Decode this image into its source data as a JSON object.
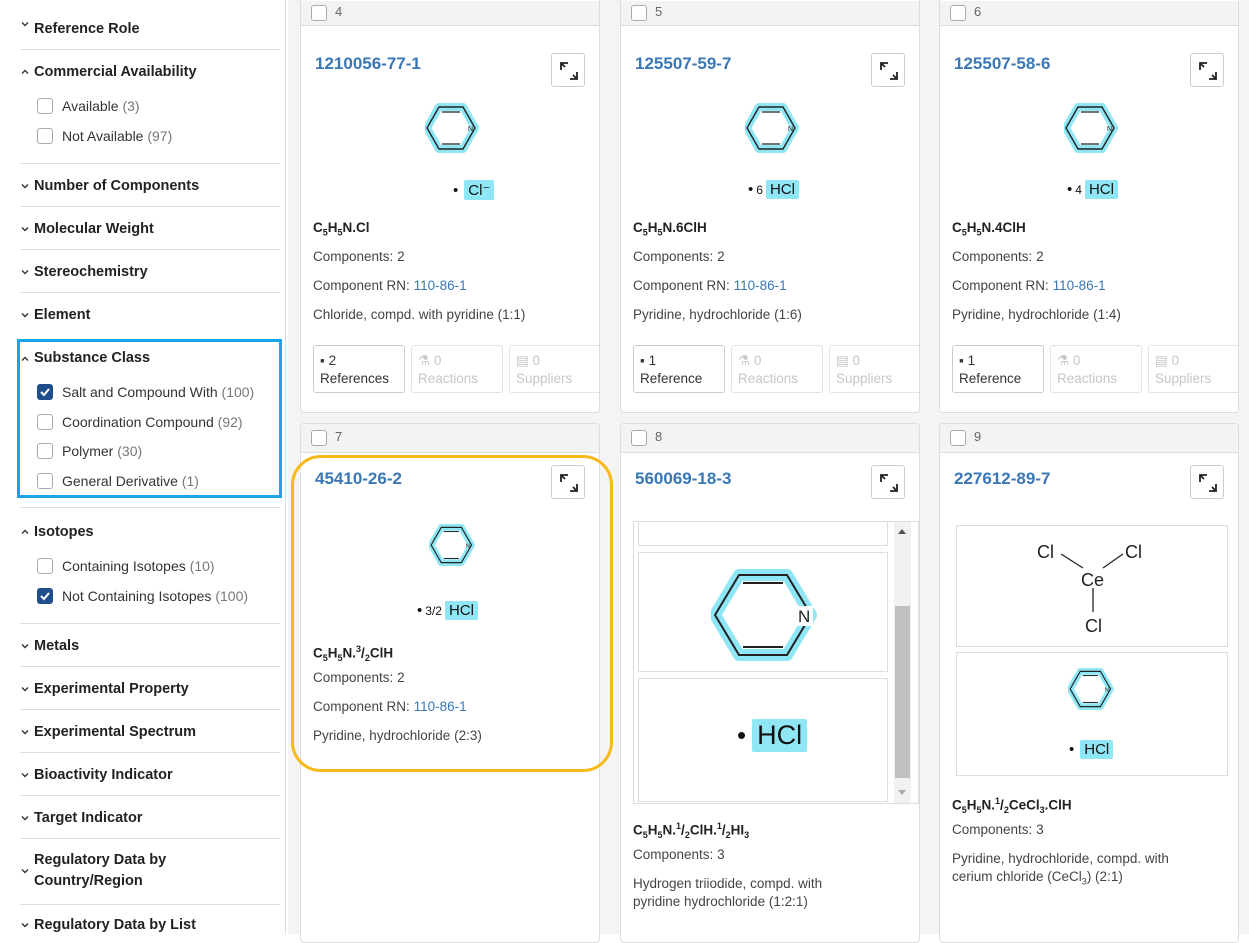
{
  "sidebar": {
    "reference_role": "Reference Role",
    "commercial": {
      "title": "Commercial Availability",
      "items": [
        {
          "label": "Available",
          "count": "(3)"
        },
        {
          "label": "Not Available",
          "count": "(97)"
        }
      ]
    },
    "number_of_components": "Number of Components",
    "molecular_weight": "Molecular Weight",
    "stereochemistry": "Stereochemistry",
    "element": "Element",
    "substance_class": {
      "title": "Substance Class",
      "items": [
        {
          "label": "Salt and Compound With",
          "count": "(100)",
          "checked": true
        },
        {
          "label": "Coordination Compound",
          "count": "(92)",
          "checked": false
        },
        {
          "label": "Polymer",
          "count": "(30)",
          "checked": false
        },
        {
          "label": "General Derivative",
          "count": "(1)",
          "checked": false
        }
      ]
    },
    "isotopes": {
      "title": "Isotopes",
      "items": [
        {
          "label": "Containing Isotopes",
          "count": "(10)",
          "checked": false
        },
        {
          "label": "Not Containing Isotopes",
          "count": "(100)",
          "checked": true
        }
      ]
    },
    "metals": "Metals",
    "experimental_property": "Experimental Property",
    "experimental_spectrum": "Experimental Spectrum",
    "bioactivity_indicator": "Bioactivity Indicator",
    "target_indicator": "Target Indicator",
    "regulatory_country_l1": "Regulatory Data by",
    "regulatory_country_l2": "Country/Region",
    "regulatory_list": "Regulatory Data by List"
  },
  "labels": {
    "components": "Components:",
    "component_rn": "Component RN:",
    "reactions": "Reactions",
    "suppliers": "Suppliers"
  },
  "cards": [
    {
      "num": "4",
      "rn": "1210056-77-1",
      "salt_ion": "Cl⁻",
      "formula_html": "C<sub>5</sub>H<sub>5</sub>N.Cl",
      "components": "2",
      "component_rn": "110-86-1",
      "name": "Chloride, compd. with pyridine (1:1)",
      "ref_count": "2",
      "ref_label": "References",
      "reactions": "0",
      "suppliers": "0"
    },
    {
      "num": "5",
      "rn": "125507-59-7",
      "salt_coef": "6",
      "salt_ion": "HCl",
      "formula_html": "C<sub>5</sub>H<sub>5</sub>N.6ClH",
      "components": "2",
      "component_rn": "110-86-1",
      "name": "Pyridine, hydrochloride (1:6)",
      "ref_count": "1",
      "ref_label": "Reference",
      "reactions": "0",
      "suppliers": "0"
    },
    {
      "num": "6",
      "rn": "125507-58-6",
      "salt_coef": "4",
      "salt_ion": "HCl",
      "formula_html": "C<sub>5</sub>H<sub>5</sub>N.4ClH",
      "components": "2",
      "component_rn": "110-86-1",
      "name": "Pyridine, hydrochloride (1:4)",
      "ref_count": "1",
      "ref_label": "Reference",
      "reactions": "0",
      "suppliers": "0"
    },
    {
      "num": "7",
      "rn": "45410-26-2",
      "salt_coef": "3/2",
      "salt_ion": "HCl",
      "formula_html": "C<sub>5</sub>H<sub>5</sub>N.<sup>3</sup>/<sub>2</sub>ClH",
      "components": "2",
      "component_rn": "110-86-1",
      "name": "Pyridine, hydrochloride (2:3)"
    },
    {
      "num": "8",
      "rn": "560069-18-3",
      "salt_ion": "HCl",
      "formula_html": "C<sub>5</sub>H<sub>5</sub>N.<sup>1</sup>/<sub>2</sub>ClH.<sup>1</sup>/<sub>2</sub>HI<sub>3</sub>",
      "components": "3",
      "name_l1": "Hydrogen triiodide, compd. with",
      "name_l2": "pyridine hydrochloride (1:2:1)"
    },
    {
      "num": "9",
      "rn": "227612-89-7",
      "salt_ion": "HCl",
      "formula_html": "C<sub>5</sub>H<sub>5</sub>N.<sup>1</sup>/<sub>2</sub>CeCl<sub>3</sub>.ClH",
      "components": "3",
      "name_l1": "Pyridine, hydrochloride, compd. with",
      "name_l2_html": "cerium chloride (CeCl<sub>3</sub>) (2:1)",
      "cecl3": {
        "atoms": [
          "Cl",
          "Cl",
          "Ce",
          "Cl"
        ]
      }
    }
  ],
  "pyridine_atom": "N",
  "colors": {
    "link": "#3a77b5",
    "highlight": "#8fe7f5",
    "filter_box": "#1aa3e8",
    "card_highlight": "#f6b917",
    "checkbox": "#1f4e8c"
  }
}
